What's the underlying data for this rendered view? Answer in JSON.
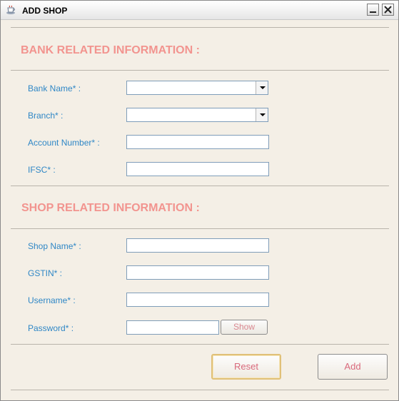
{
  "window": {
    "title": "ADD SHOP"
  },
  "bank_section": {
    "heading": "BANK RELATED INFORMATION :",
    "bank_name_label": "Bank Name* :",
    "bank_name_value": "",
    "branch_label": "Branch* :",
    "branch_value": "",
    "account_number_label": "Account Number* :",
    "account_number_value": "",
    "ifsc_label": "IFSC* :",
    "ifsc_value": ""
  },
  "shop_section": {
    "heading": "SHOP RELATED INFORMATION :",
    "shop_name_label": "Shop Name* :",
    "shop_name_value": "",
    "gstin_label": "GSTIN* :",
    "gstin_value": "",
    "username_label": "Username* :",
    "username_value": "",
    "password_label": "Password* :",
    "password_value": "",
    "show_label": "Show"
  },
  "actions": {
    "reset_label": "Reset",
    "add_label": "Add"
  },
  "colors": {
    "heading": "#f2948f",
    "label": "#2f87c6",
    "button_text": "#d9697c",
    "background": "#f4efe6"
  },
  "icons": {
    "app": "coffee-cup-icon",
    "minimize": "minimize-icon",
    "close": "close-icon",
    "dropdown": "chevron-down-icon"
  }
}
